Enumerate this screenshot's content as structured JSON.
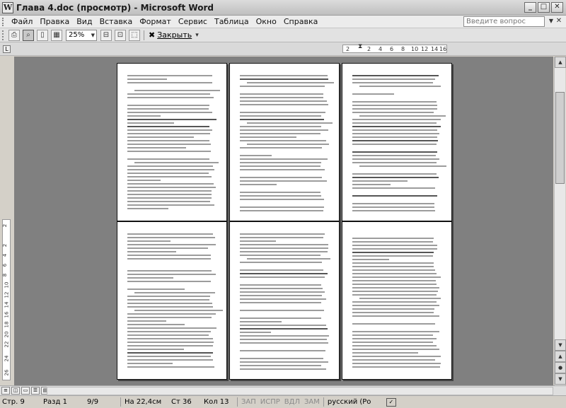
{
  "window": {
    "title": "Глава 4.doc (просмотр) - Microsoft Word",
    "app_icon": "W",
    "controls": [
      "_",
      "□",
      "✕"
    ]
  },
  "menu": {
    "items": [
      "Файл",
      "Правка",
      "Вид",
      "Вставка",
      "Формат",
      "Сервис",
      "Таблица",
      "Окно",
      "Справка"
    ],
    "help_placeholder": "Введите вопрос",
    "doc_close": "✕"
  },
  "toolbar": {
    "zoom_value": "25%",
    "close_label": "Закрыть",
    "close_icon": "close-icon"
  },
  "ruler": {
    "numbers": [
      "2",
      "2",
      "4",
      "6",
      "8",
      "10",
      "12",
      "14",
      "16"
    ],
    "vertical_numbers": [
      "2",
      "2",
      "4",
      "6",
      "8",
      "10",
      "12",
      "14",
      "16",
      "18",
      "20",
      "22",
      "24",
      "26"
    ]
  },
  "status": {
    "page": "Стр. 9",
    "section": "Разд 1",
    "pages": "9/9",
    "position": "На 22,4см",
    "line": "Ст 36",
    "column": "Кол 13",
    "rec": "ЗАП",
    "track": "ИСПР",
    "ext": "ВДЛ",
    "ovr": "ЗАМ",
    "language": "русский (Ро"
  }
}
